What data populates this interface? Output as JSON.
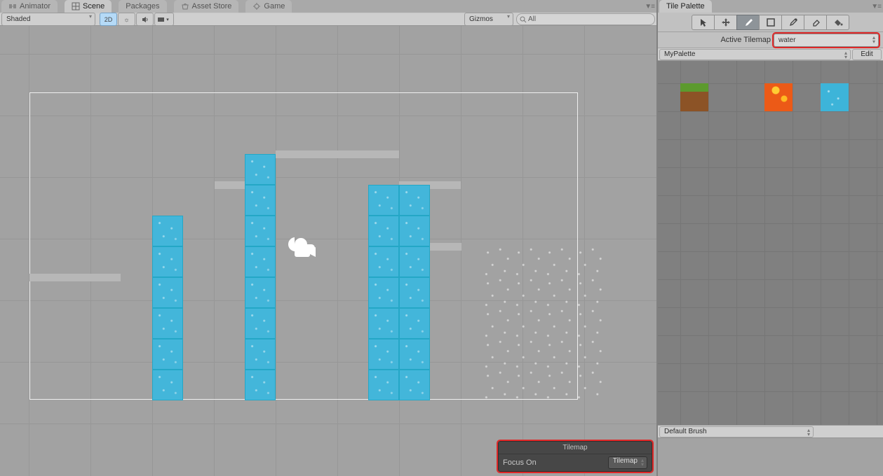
{
  "tabs": {
    "left": [
      {
        "label": "Animator"
      },
      {
        "label": "Scene"
      },
      {
        "label": "Packages"
      },
      {
        "label": "Asset Store"
      },
      {
        "label": "Game"
      }
    ],
    "right": [
      {
        "label": "Tile Palette"
      }
    ]
  },
  "scene_toolbar": {
    "shading": "Shaded",
    "mode2d": "2D",
    "gizmos": "Gizmos",
    "search_placeholder": "All"
  },
  "overlay": {
    "title": "Tilemap",
    "focus_label": "Focus On",
    "focus_value": "Tilemap"
  },
  "palette": {
    "active_label": "Active Tilemap",
    "active_value": "water",
    "palette_name": "MyPalette",
    "edit_label": "Edit",
    "brush": "Default Brush"
  }
}
